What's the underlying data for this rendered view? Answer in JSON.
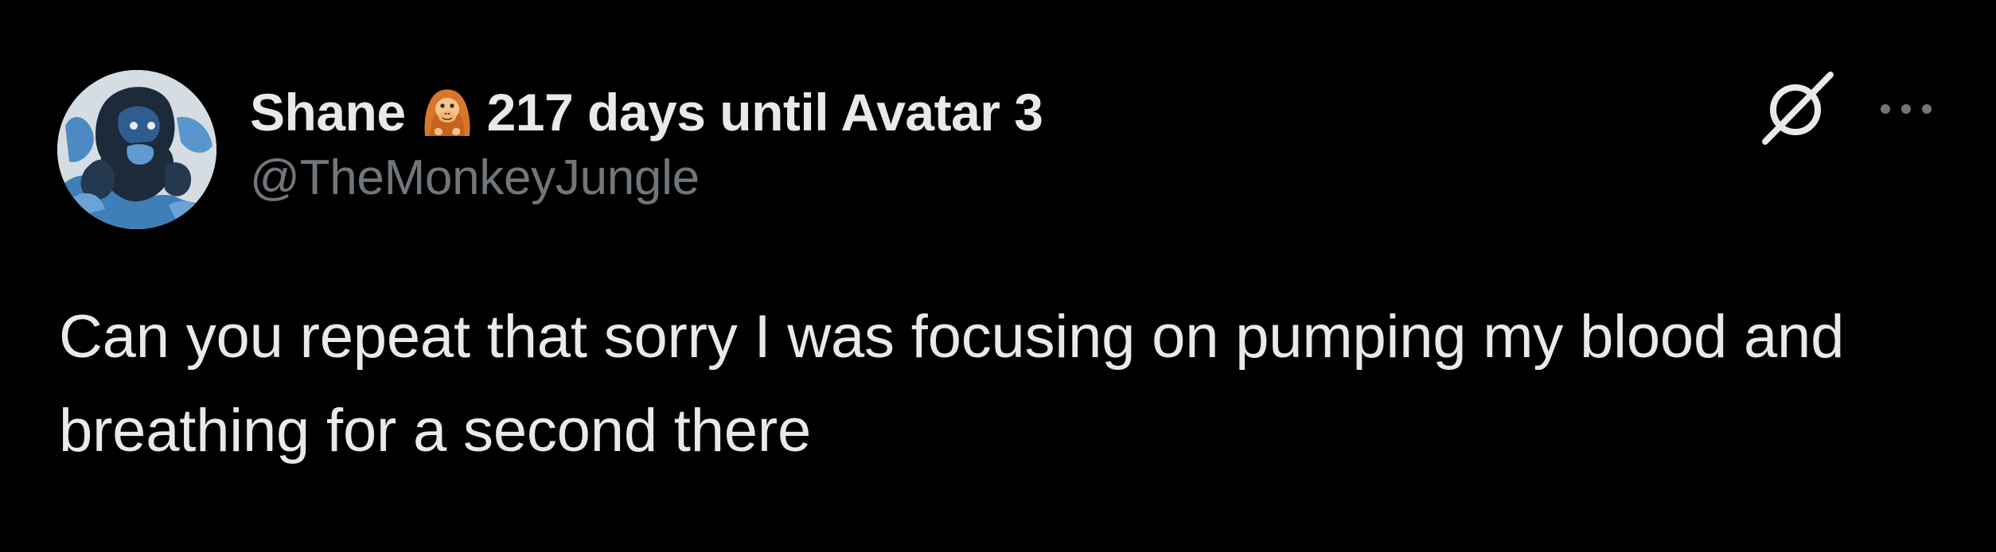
{
  "tweet": {
    "author": {
      "display_name": "Shane",
      "name_suffix": "217 days until Avatar 3",
      "handle": "@TheMonkeyJungle",
      "avatar_icon": "gorilla-avatar",
      "emoji_icon": "orangutan-emoji"
    },
    "text": "Can you repeat that sorry I was focusing on pumping my blood and breathing for a second there",
    "actions": {
      "grok_icon": "grok-icon",
      "more_icon": "more-options-icon"
    }
  },
  "colors": {
    "background": "#000000",
    "primary_text": "#e7e9ea",
    "secondary_text": "#71767b",
    "emoji_orange": "#d9762b"
  }
}
